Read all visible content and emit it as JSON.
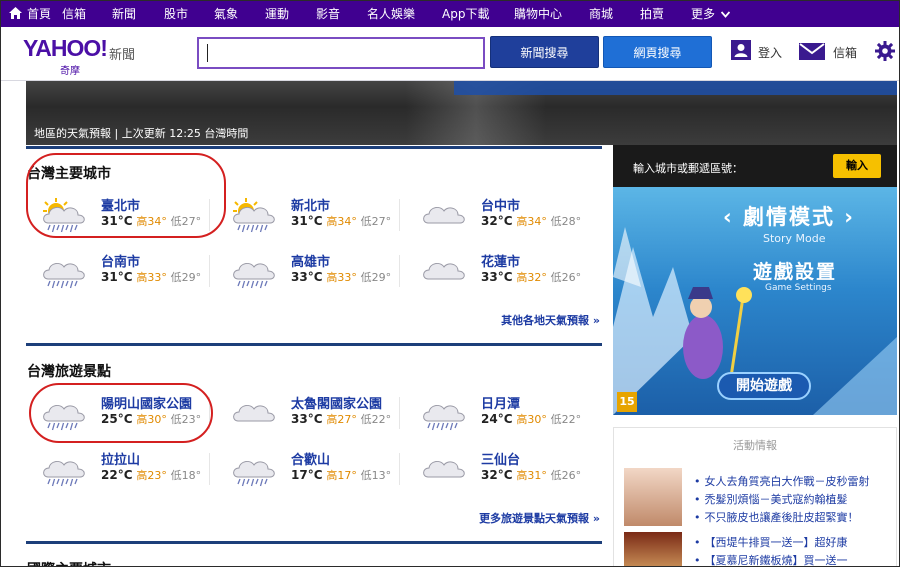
{
  "topnav": {
    "items": [
      "首頁",
      "信箱",
      "新聞",
      "股市",
      "氣象",
      "運動",
      "影音",
      "名人娛樂",
      "App下載",
      "購物中心",
      "商城",
      "拍賣",
      "更多"
    ]
  },
  "header": {
    "logo": "YAHOO!",
    "logo_sub": "奇摩",
    "product": "新聞",
    "news_search": "新聞搜尋",
    "web_search": "網頁搜尋",
    "login": "登入",
    "mail": "信箱"
  },
  "banner": {
    "caption": "地區的天氣預報 | 上次更新 12:25 台灣時間"
  },
  "taiwan_cities": {
    "title": "台灣主要城市",
    "more": "其他各地天氣預報 »",
    "cities": [
      {
        "name": "臺北市",
        "temp": "31°C",
        "high": "高34°",
        "low": "低27°",
        "icon": "sun-cloud-rain"
      },
      {
        "name": "新北市",
        "temp": "31°C",
        "high": "高34°",
        "low": "低27°",
        "icon": "sun-cloud-rain"
      },
      {
        "name": "台中市",
        "temp": "32°C",
        "high": "高34°",
        "low": "低28°",
        "icon": "cloud"
      },
      {
        "name": "台南市",
        "temp": "31°C",
        "high": "高33°",
        "low": "低29°",
        "icon": "cloud-rain"
      },
      {
        "name": "高雄市",
        "temp": "33°C",
        "high": "高33°",
        "low": "低29°",
        "icon": "cloud-rain"
      },
      {
        "name": "花蓮市",
        "temp": "33°C",
        "high": "高32°",
        "low": "低26°",
        "icon": "cloud"
      }
    ]
  },
  "taiwan_spots": {
    "title": "台灣旅遊景點",
    "more": "更多旅遊景點天氣預報 »",
    "cities": [
      {
        "name": "陽明山國家公園",
        "temp": "25°C",
        "high": "高30°",
        "low": "低23°",
        "icon": "cloud-rain"
      },
      {
        "name": "太魯閣國家公園",
        "temp": "33°C",
        "high": "高27°",
        "low": "低22°",
        "icon": "cloud"
      },
      {
        "name": "日月潭",
        "temp": "24°C",
        "high": "高30°",
        "low": "低22°",
        "icon": "cloud-rain"
      },
      {
        "name": "拉拉山",
        "temp": "22°C",
        "high": "高23°",
        "low": "低18°",
        "icon": "cloud-rain"
      },
      {
        "name": "合歡山",
        "temp": "17°C",
        "high": "高17°",
        "low": "低13°",
        "icon": "cloud-rain"
      },
      {
        "name": "三仙台",
        "temp": "32°C",
        "high": "高31°",
        "low": "低26°",
        "icon": "cloud"
      }
    ]
  },
  "next_section": {
    "title": "國際主要城市"
  },
  "zip": {
    "label": "輸入城市或郵遞區號：",
    "button": "輸入"
  },
  "ad": {
    "title": "‹ 劇情模式 ›",
    "sub1": "Story Mode",
    "title2": "遊戲設置",
    "sub2": "Game Settings",
    "start": "開始遊戲",
    "rating": "15"
  },
  "activity": {
    "title": "活動情報",
    "items": [
      "女人去角質亮白大作戰－皮秒雷射",
      "禿髮別煩惱－美式寇約翰植髮",
      "不只腋皮也讓產後肚皮超緊實！",
      "【西堤牛排買一送一】超好康",
      "【夏慕尼新鐵板燒】買一送一"
    ]
  }
}
